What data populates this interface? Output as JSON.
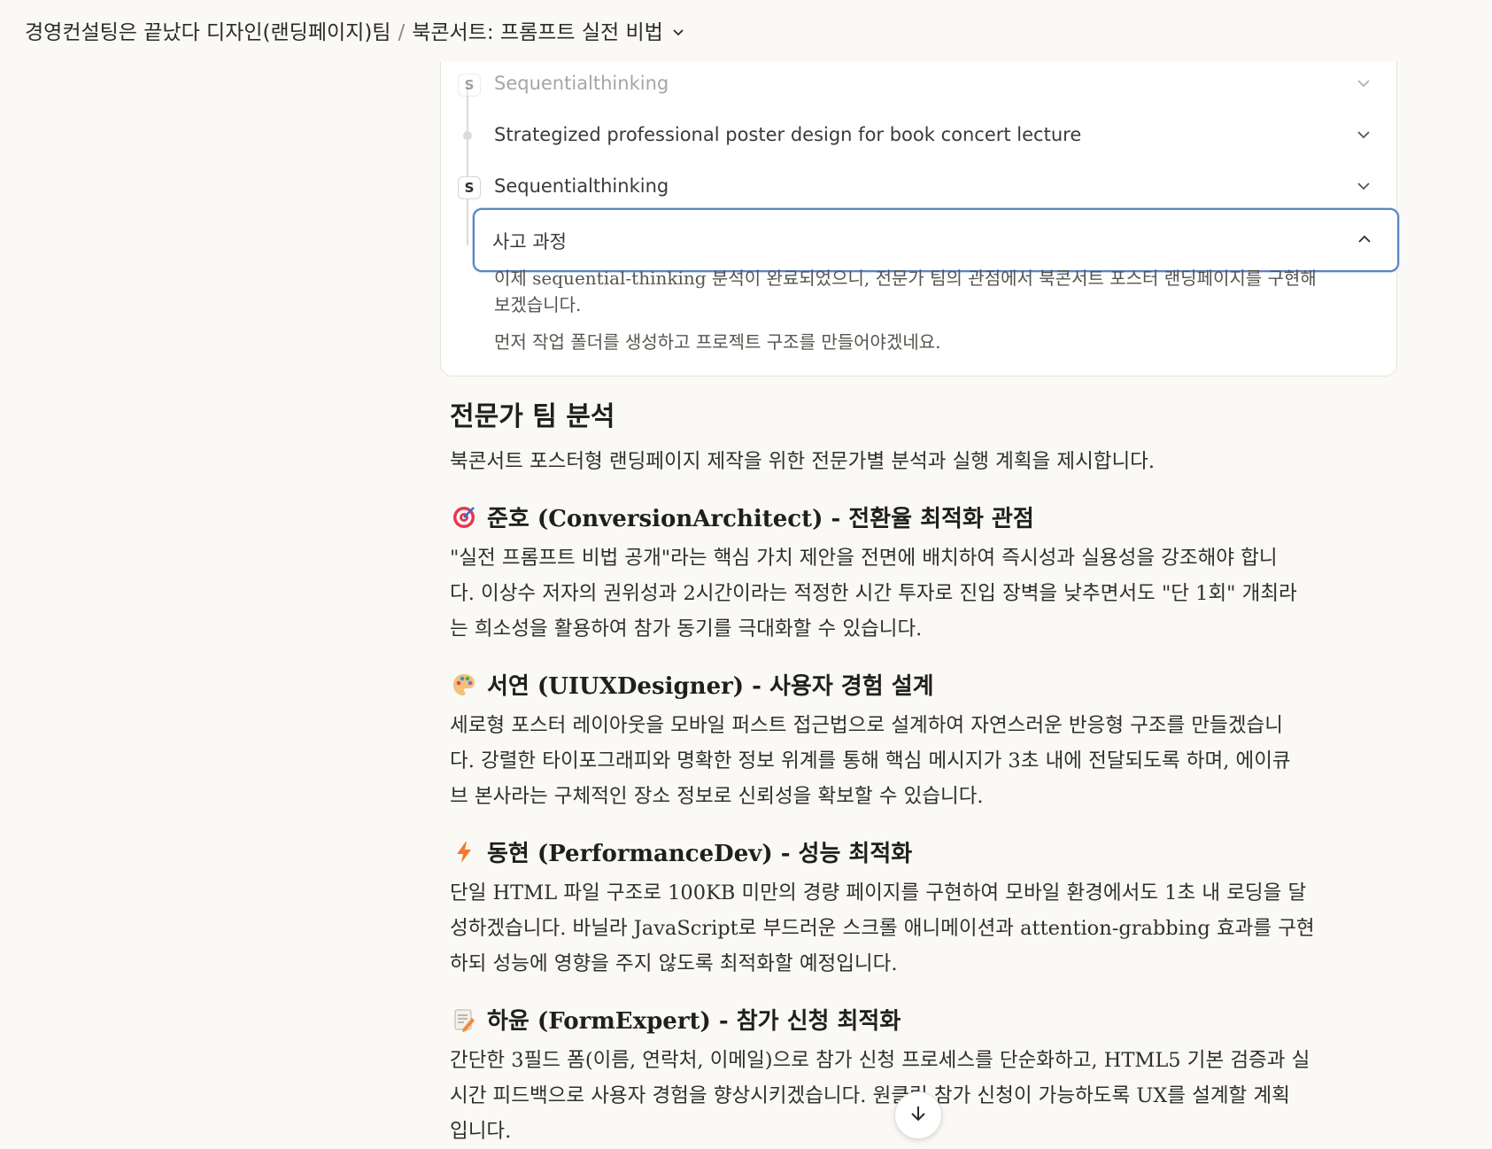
{
  "header": {
    "project": "경영컨설팅은 끝났다 디자인(랜딩페이지)팀",
    "separator": "/",
    "chat_title": "북콘서트: 프롬프트 실전 비법"
  },
  "thinking": {
    "steps": [
      {
        "badge": "S",
        "label": "Sequentialthinking"
      },
      {
        "label": "Strategized professional poster design for book concert lecture"
      },
      {
        "badge": "S",
        "label": "Sequentialthinking"
      },
      {
        "label": "사고 과정"
      }
    ],
    "paragraphs": [
      "이제 sequential-thinking 분석이 완료되었으니, 전문가 팀의 관점에서 북콘서트 포스터 랜딩페이지를 구현해",
      "보겠습니다.",
      "먼저 작업 폴더를 생성하고 프로젝트 구조를 만들어야겠네요."
    ]
  },
  "content": {
    "title": "전문가 팀 분석",
    "intro": "북콘서트 포스터형 랜딩페이지 제작을 위한 전문가별 분석과 실행 계획을 제시합니다.",
    "sections": [
      {
        "icon": "target-icon",
        "heading": "준호 (ConversionArchitect) - 전환율 최적화 관점",
        "lines": [
          "\"실전 프롬프트 비법 공개\"라는 핵심 가치 제안을 전면에 배치하여 즉시성과 실용성을 강조해야 합니",
          "다. 이상수 저자의 권위성과 2시간이라는 적정한 시간 투자로 진입 장벽을 낮추면서도 \"단 1회\" 개최라",
          "는 희소성을 활용하여 참가 동기를 극대화할 수 있습니다."
        ]
      },
      {
        "icon": "palette-icon",
        "heading": "서연 (UIUXDesigner) - 사용자 경험 설계",
        "lines": [
          "세로형 포스터 레이아웃을 모바일 퍼스트 접근법으로 설계하여 자연스러운 반응형 구조를 만들겠습니",
          "다. 강렬한 타이포그래피와 명확한 정보 위계를 통해 핵심 메시지가 3초 내에 전달되도록 하며, 에이큐",
          "브 본사라는 구체적인 장소 정보로 신뢰성을 확보할 수 있습니다."
        ]
      },
      {
        "icon": "lightning-icon",
        "heading": "동현 (PerformanceDev) - 성능 최적화",
        "lines": [
          "단일 HTML 파일 구조로 100KB 미만의 경량 페이지를 구현하여 모바일 환경에서도 1초 내 로딩을 달",
          "성하겠습니다. 바닐라 JavaScript로 부드러운 스크롤 애니메이션과 attention-grabbing 효과를 구현",
          "하되 성능에 영향을 주지 않도록 최적화할 예정입니다."
        ]
      },
      {
        "icon": "memo-icon",
        "heading": "하윤 (FormExpert) - 참가 신청 최적화",
        "lines": [
          "간단한 3필드 폼(이름, 연락처, 이메일)으로 참가 신청 프로세스를 단순화하고, HTML5 기본 검증과 실",
          "시간 피드백으로 사용자 경험을 향상시키겠습니다. 원클릭 참가 신청이 가능하도록 UX를 설계할 계획",
          "입니다."
        ]
      }
    ]
  }
}
